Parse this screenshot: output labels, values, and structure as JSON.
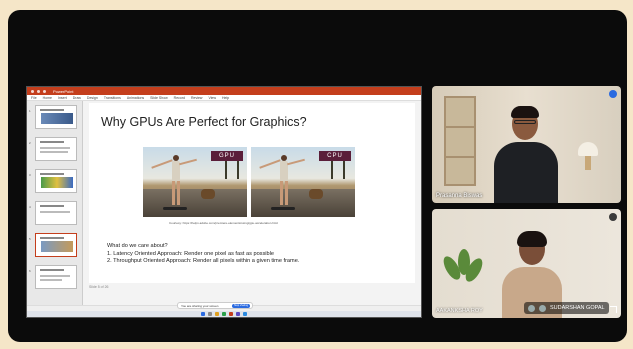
{
  "presentation": {
    "app_title": "PowerPoint",
    "ribbon_tabs": [
      "File",
      "Home",
      "Insert",
      "Draw",
      "Design",
      "Transitions",
      "Animations",
      "Slide Show",
      "Record",
      "Review",
      "View",
      "Help"
    ],
    "slide_title": "Why GPUs Are Perfect for Graphics?",
    "left_tag": "GPU",
    "right_tag": "CPU",
    "caption": "Courtesy: https://helpx.adobe.com/premiere-elements/using/gpu-acceleration.html",
    "question": "What do we care about?",
    "points": [
      "1.   Latency Oriented Approach: Render one pixel as fast as possible",
      "2.   Throughput Oriented Approach: Render all pixels within a given time frame."
    ],
    "thumb_numbers": [
      "1",
      "2",
      "3",
      "4",
      "5",
      "6"
    ],
    "footer": "Slide 5 of 26",
    "share_notice": "You are sharing your screen",
    "stop_sharing": "Stop sharing"
  },
  "participants": [
    {
      "name": "Prasanna Biswas"
    },
    {
      "name": "AAKANKSHA ROY"
    }
  ],
  "controls": {
    "presenter_label": "SUDARSHAN GOPAL"
  },
  "colors": {
    "ppt_red": "#c43e1c",
    "tag_bg": "#5a1e3a",
    "accent_blue": "#2a6ae0"
  }
}
